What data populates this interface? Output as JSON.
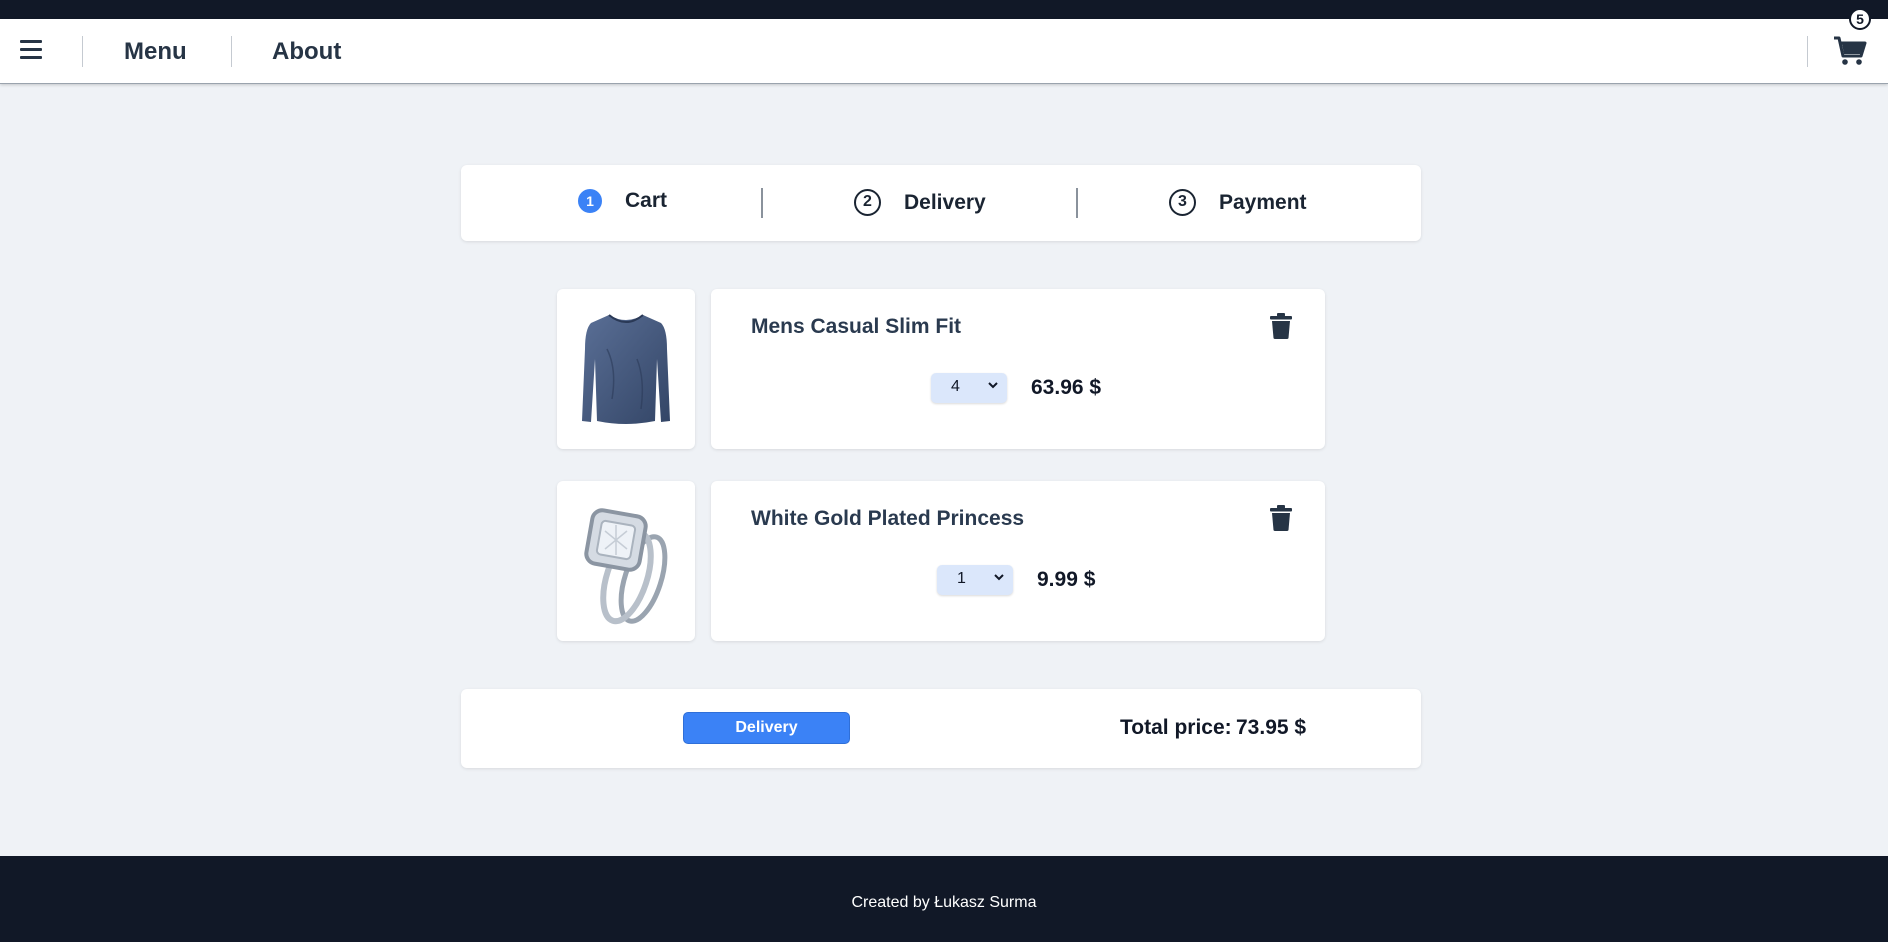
{
  "header": {
    "menu_label": "Menu",
    "about_label": "About",
    "cart_count": "5"
  },
  "steps": [
    {
      "number": "1",
      "label": "Cart",
      "active": true
    },
    {
      "number": "2",
      "label": "Delivery",
      "active": false
    },
    {
      "number": "3",
      "label": "Payment",
      "active": false
    }
  ],
  "cart_items": [
    {
      "name": "Mens Casual Slim Fit",
      "quantity": "4",
      "price": "63.96 $",
      "image": "long-sleeve-shirt-image"
    },
    {
      "name": "White Gold Plated Princess",
      "quantity": "1",
      "price": "9.99 $",
      "image": "diamond-ring-image"
    }
  ],
  "summary": {
    "button_label": "Delivery",
    "total_label": "Total price:",
    "total_value": "73.95 $"
  },
  "footer": {
    "text": "Created by Łukasz Surma"
  },
  "colors": {
    "accent": "#3b82f6",
    "navbar_bg": "#ffffff",
    "dark_bar": "#111827",
    "page_bg": "#eff2f6",
    "select_bg": "#dbe7fb"
  }
}
